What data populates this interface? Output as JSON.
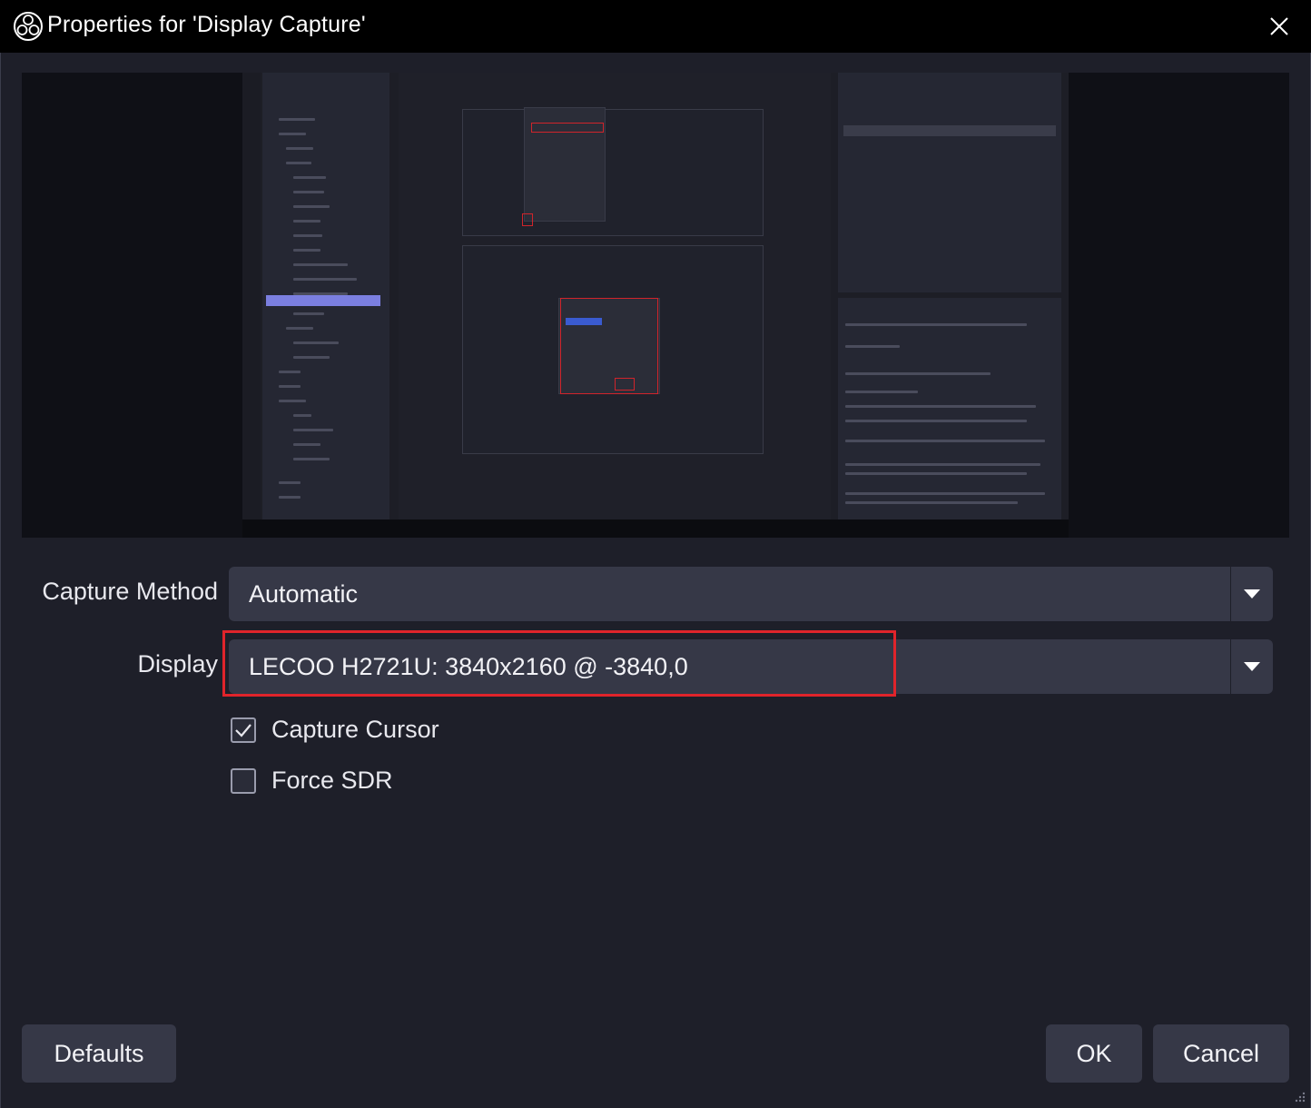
{
  "window": {
    "title": "Properties for 'Display Capture'",
    "icon": "obs-logo-icon",
    "close_icon": "close-icon"
  },
  "preview": {
    "description_icon": "display-capture-preview"
  },
  "form": {
    "capture_method": {
      "label": "Capture Method",
      "value": "Automatic"
    },
    "display": {
      "label": "Display",
      "value": "LECOO H2721U: 3840x2160 @ -3840,0"
    },
    "capture_cursor": {
      "label": "Capture Cursor",
      "checked": true
    },
    "force_sdr": {
      "label": "Force SDR",
      "checked": false
    }
  },
  "buttons": {
    "defaults": "Defaults",
    "ok": "OK",
    "cancel": "Cancel"
  },
  "colors": {
    "background": "#1e1f29",
    "control": "#363847",
    "highlight": "#e0242b"
  }
}
